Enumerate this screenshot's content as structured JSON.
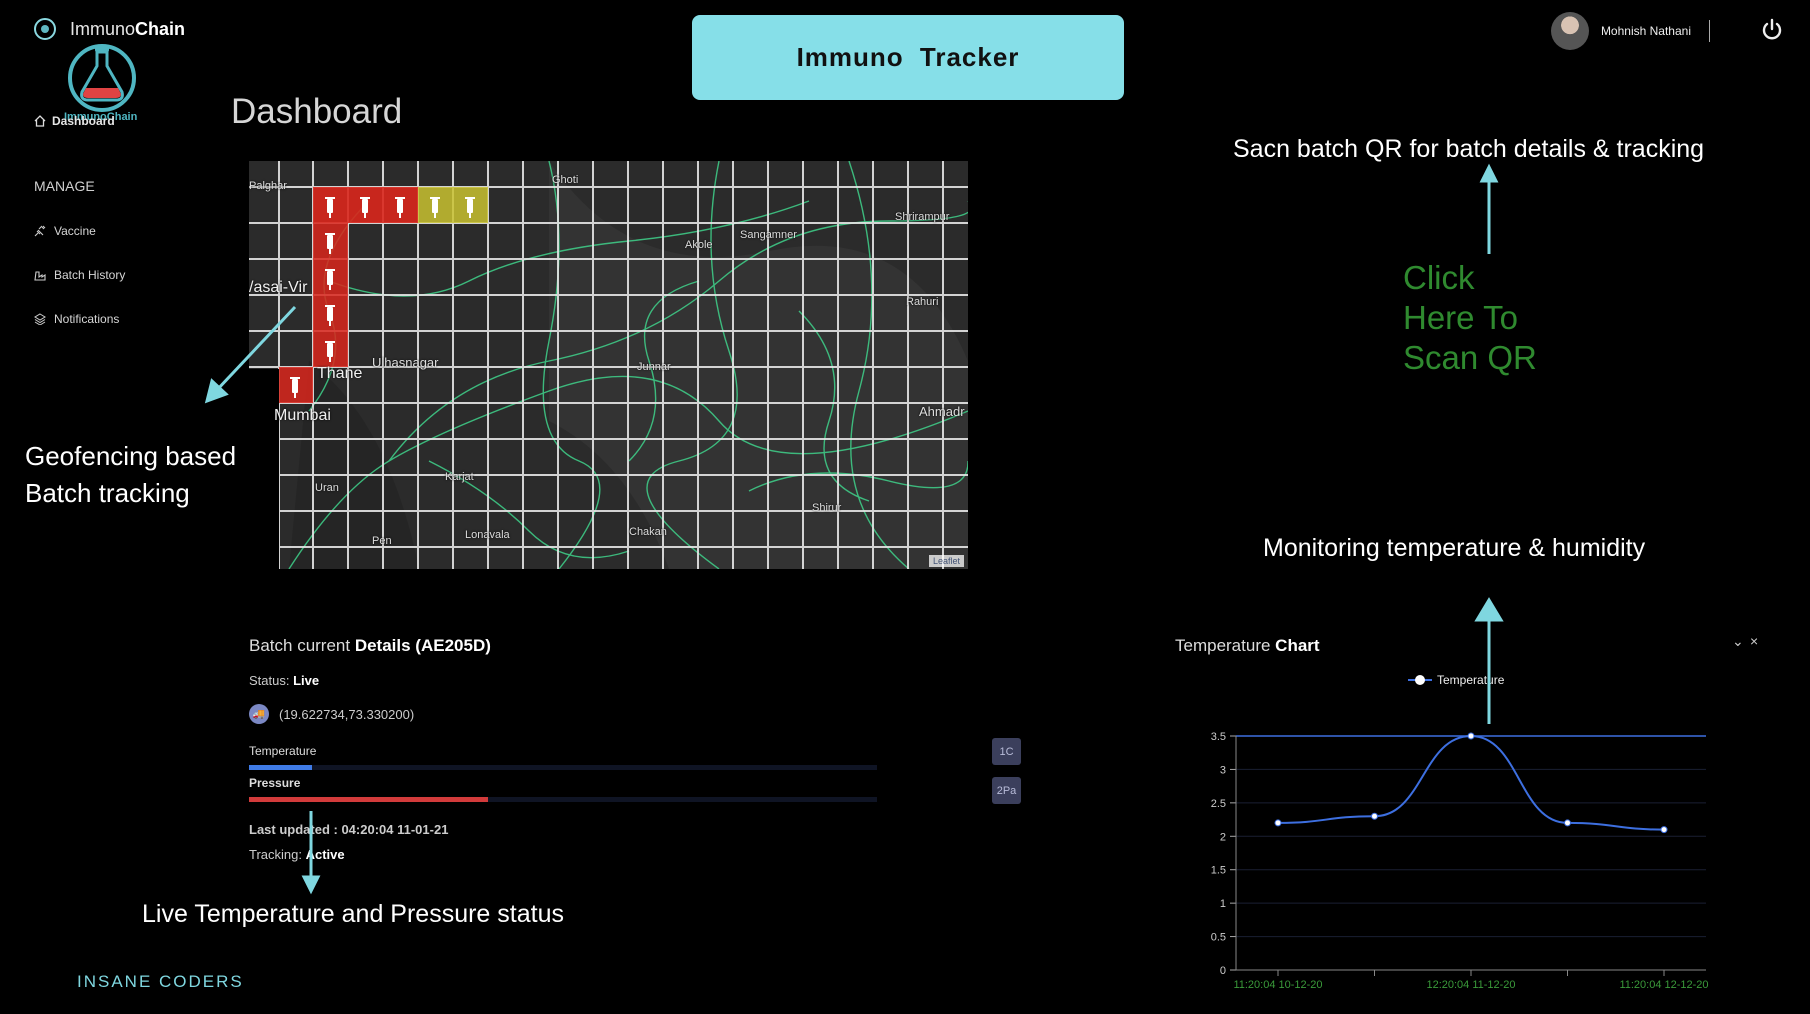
{
  "header": {
    "brand_prefix": "Immuno",
    "brand_bold": "Chain",
    "logo_label": "ImmunoChain",
    "title": "Immuno Tracker",
    "user_name": "Mohnish Nathani",
    "icons": {
      "logo": "flask-logo-icon",
      "power": "power-icon",
      "avatar": "user-avatar"
    }
  },
  "sidebar": {
    "dashboard_label": "Dashboard",
    "section_label": "MANAGE",
    "items": [
      {
        "label": "Vaccine",
        "icon": "syringe-icon"
      },
      {
        "label": "Batch History",
        "icon": "history-icon"
      },
      {
        "label": "Notifications",
        "icon": "bell-icon"
      }
    ]
  },
  "page_title": "Dashboard",
  "map": {
    "places": [
      "Palghar",
      "Ghoti",
      "Sangamner",
      "Akole",
      "Shrirampur",
      "Rahuri",
      "/asai-Vir",
      "Thane",
      "Ulhasnagar",
      "Mumbai",
      "Junnar",
      "Ahmadr",
      "Karjat",
      "Uran",
      "Shirur",
      "Pen",
      "Lonavala",
      "Chakan",
      "Sangamner"
    ],
    "attribution": "Leaflet",
    "geofence_colors": {
      "visited": "#d9261c",
      "current": "#c9c230"
    },
    "route_color": "#3fd28b"
  },
  "annotations": {
    "geofence": [
      "Geofencing based",
      "Batch tracking"
    ],
    "live_status": "Live Temperature and Pressure status",
    "scan_qr": "Sacn batch QR for batch details & tracking",
    "click_here": [
      "Click",
      "Here To",
      "Scan QR"
    ],
    "monitoring": "Monitoring temperature & humidity",
    "arrow_color": "#7fd7e0"
  },
  "batch": {
    "title_prefix": "Batch current ",
    "title_bold": "Details (AE205D)",
    "status_label": "Status: ",
    "status_value": "Live",
    "coordinates": "(19.622734,73.330200)",
    "temperature_label": "Temperature",
    "temperature_fraction": 0.1,
    "temperature_color": "#3f7be6",
    "temperature_unit": "1C",
    "pressure_label": "Pressure",
    "pressure_fraction": 0.38,
    "pressure_color": "#d23b3b",
    "pressure_unit": "2Pa",
    "last_updated": "Last updated : 04:20:04 11-01-21",
    "tracking_label": "Tracking: ",
    "tracking_value": "Active"
  },
  "chart_panel": {
    "title_prefix": "Temperature ",
    "title_bold": "Chart",
    "collapse": "⌄",
    "close": "×"
  },
  "chart_data": {
    "type": "line",
    "title": "",
    "xlabel": "",
    "ylabel": "",
    "series": [
      {
        "name": "Temperature",
        "values": [
          2.2,
          2.3,
          3.5,
          2.2,
          2.1
        ]
      }
    ],
    "x": [
      "11:20:04 10-12-20",
      "",
      "12:20:04 11-12-20",
      "",
      "11:20:04 12-12-20"
    ],
    "x_tick_labels": [
      "11:20:04 10-12-20",
      "12:20:04 11-12-20",
      "11:20:04 12-12-20"
    ],
    "y_ticks": [
      "0",
      "0.5",
      "1",
      "1.5",
      "2",
      "2.5",
      "3",
      "3.5"
    ],
    "ylim": [
      0,
      3.5
    ],
    "legend": "top-center",
    "line_color": "#3d6fe0",
    "max_line_color": "#3d6fe0"
  },
  "footer": "INSANE CODERS"
}
